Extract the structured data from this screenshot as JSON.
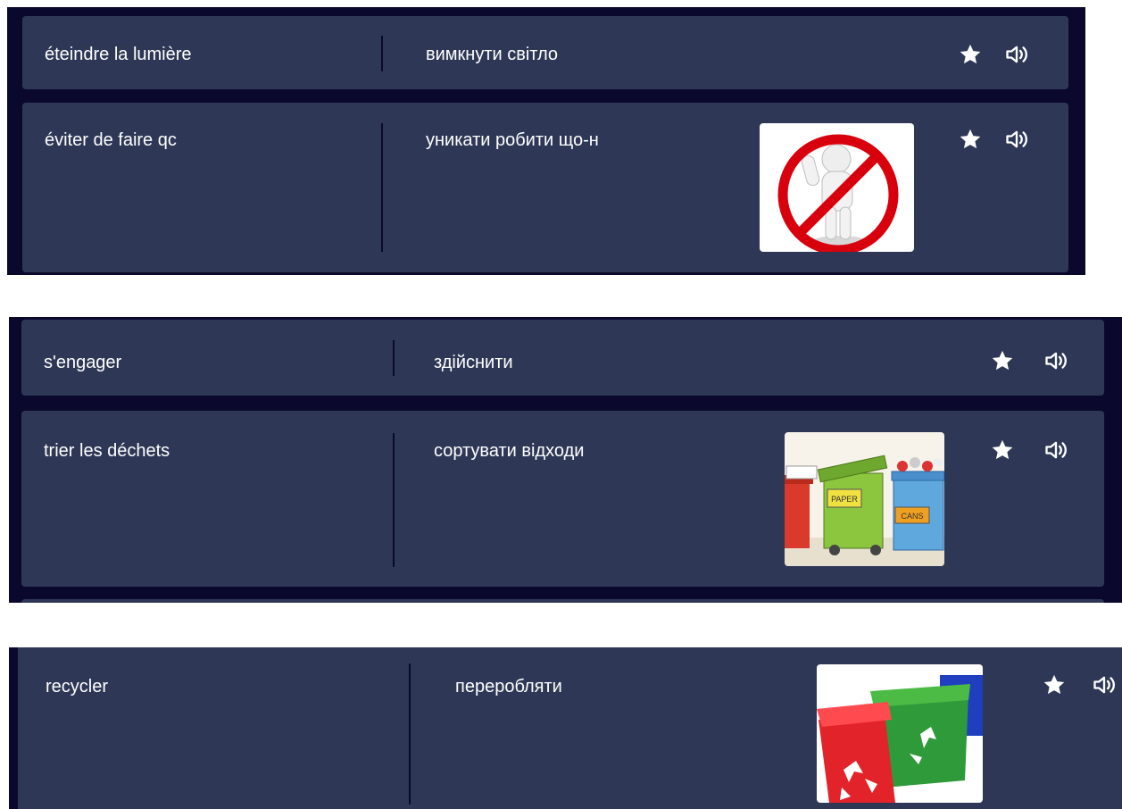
{
  "cards": [
    {
      "term": "éteindre la lumière",
      "definition": "вимкнути світло"
    },
    {
      "term": "éviter de faire qc",
      "definition": "уникати робити що-н"
    },
    {
      "term": "s'engager",
      "definition": "здійснити"
    },
    {
      "term": "trier les déchets",
      "definition": "сортувати відходи"
    },
    {
      "term": "recycler",
      "definition": "переробляти"
    }
  ],
  "images": [
    {
      "name": "prohibition-figure-image",
      "labels": []
    },
    {
      "name": "sorting-bins-image",
      "labels": [
        "PAPER",
        "CANS"
      ]
    },
    {
      "name": "recycling-bins-image",
      "labels": []
    }
  ],
  "icons": {
    "star": "star-icon",
    "audio": "speaker-icon"
  },
  "colors": {
    "panel_bg": "#0a092d",
    "card_bg": "#2e3856",
    "text": "#ffffff",
    "divider": "#0a092d"
  }
}
